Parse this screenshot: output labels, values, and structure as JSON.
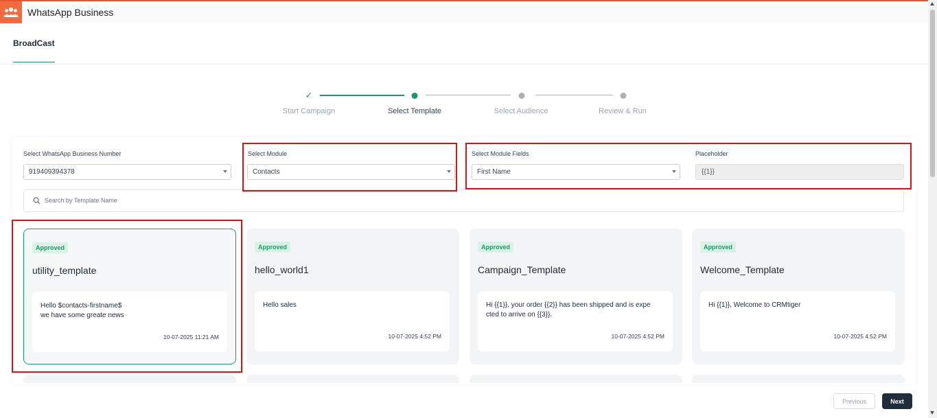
{
  "app": {
    "title": "WhatsApp Business",
    "logo_icon": "users-group-icon",
    "accent": "#f26a3d"
  },
  "tabs": [
    {
      "label": "BroadCast",
      "active": true
    }
  ],
  "stepper": {
    "steps": [
      {
        "label": "Start Campaign",
        "state": "done"
      },
      {
        "label": "Select Template",
        "state": "active"
      },
      {
        "label": "Select Audience",
        "state": "pending"
      },
      {
        "label": "Review & Run",
        "state": "pending"
      }
    ]
  },
  "form": {
    "business_number": {
      "label": "Select WhatsApp Business Number",
      "value": "919409394378"
    },
    "module": {
      "label": "Select Module",
      "value": "Contacts"
    },
    "module_fields": {
      "label": "Select Module Fields",
      "value": "First Name"
    },
    "placeholder": {
      "label": "Placeholder",
      "value": "{{1}}"
    },
    "search": {
      "placeholder": "Search by Template Name"
    }
  },
  "templates": [
    {
      "status": "Approved",
      "name": "utility_template",
      "body": "Hello $contacts-firstname$\nwe have some greate news",
      "time": "10-07-2025 11:21 AM",
      "selected": true
    },
    {
      "status": "Approved",
      "name": "hello_world1",
      "body": "Hello sales",
      "time": "10-07-2025 4:52 PM",
      "selected": false
    },
    {
      "status": "Approved",
      "name": "Campaign_Template",
      "body": "Hi {{1}}, your order {{2}} has been shipped and is expe\ncted to arrive on {{3}}.",
      "time": "10-07-2025 4:52 PM",
      "selected": false
    },
    {
      "status": "Approved",
      "name": "Welcome_Template",
      "body": "Hi {{1}}, Welcome to CRMtiger",
      "time": "10-07-2025 4:52 PM",
      "selected": false
    }
  ],
  "footer": {
    "previous_label": "Previous",
    "next_label": "Next"
  },
  "colors": {
    "success": "#1a9a6c",
    "highlight": "#dd1111",
    "primary_button": "#1f2d3d"
  }
}
